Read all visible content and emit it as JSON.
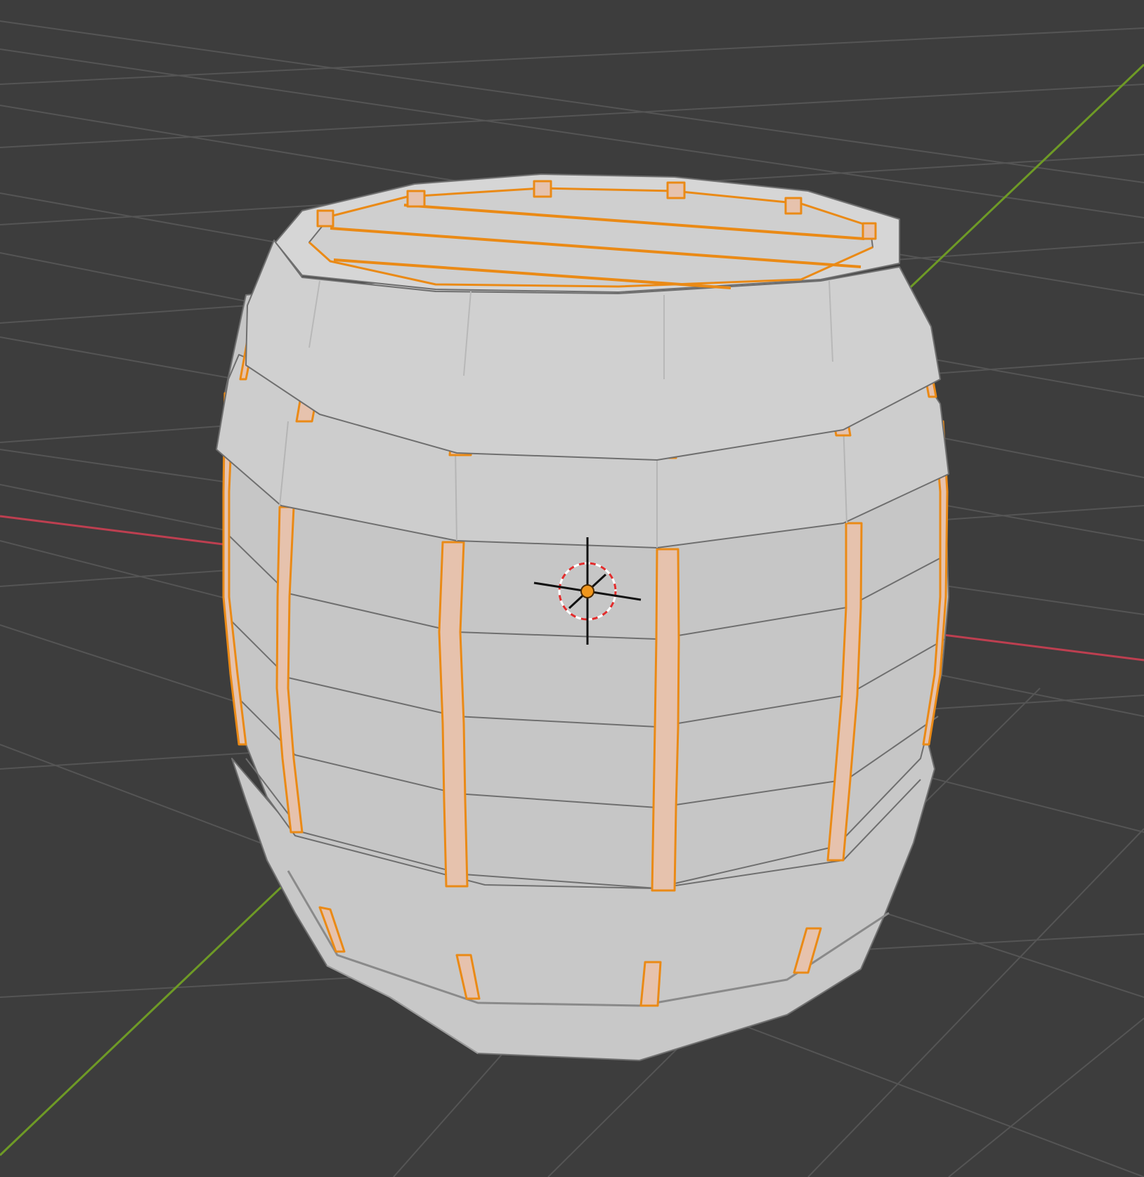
{
  "viewport": {
    "mode": "3d-viewport",
    "object": "barrel-mesh",
    "colors": {
      "background": "#3d3d3d",
      "grid": "#555555",
      "axis_x": "#bd3f50",
      "axis_y": "#6e9a26",
      "mesh_face": "#c6c6c6",
      "mesh_face_light": "#d4d4d4",
      "mesh_face_dark": "#b6b6b6",
      "mesh_edge": "#6f6f6f",
      "selected_edge": "#ea8a16",
      "selected_face": "#e6c2ad",
      "origin": "#f0961c",
      "cursor_red": "#e12c2c"
    },
    "icons": {
      "cursor": "3d-cursor-icon",
      "origin": "object-origin-icon"
    }
  }
}
